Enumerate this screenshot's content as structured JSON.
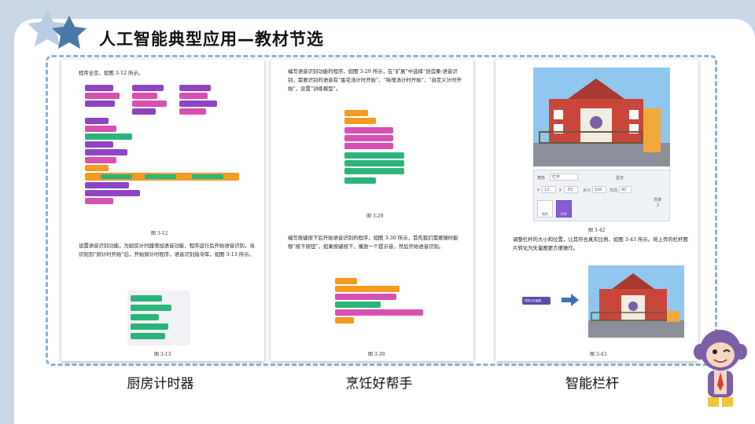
{
  "header": {
    "title": "人工智能典型应用—教材节选"
  },
  "pages": [
    {
      "text_top": "程序全览，如图 3-12 所示。",
      "fig_a": "图 3-12",
      "body": "设置语音识别功能，为厨房计时器增加语音功能，程序运行后开始语音识别，当识别到“倒计时开始”后，开始倒计时程序，语音识别指令库，如图 3-13 所示。",
      "fig_b": "图 3-13",
      "label": "厨房计时器"
    },
    {
      "text_top": "编写语音识别功能的程序，如图 3-29 所示，在“扩展”中选择“创造栗-语音识别，需要识别的语音有“蛋花汤计时开始”、“咏增汤计时开始”、“自定义计时开始”，设置“训练模型”。",
      "fig_a": "图 3-29",
      "body": "编写按键按下后开始语音识别的程序，如图 3-30 所示，首先我们需要随时能够“按下按钮”，如果按键按下，播放一个提示音，然后开始语音识别。",
      "fig_b": "图 3-30",
      "label": "烹饪好帮手"
    },
    {
      "fig_a": "图 3-42",
      "body": "调整栏杆的大小和位置，让其符合真实比例，如图 3-43 所示。将上传的栏杆图片转化为矢量图更方便操作。",
      "fig_b": "图 3-43",
      "label": "智能栏杆",
      "panel": {
        "role_label": "角色",
        "role_name": "栏杆",
        "show_label": "显示",
        "x_label": "x",
        "x_value": "12",
        "y_label": "y",
        "y_value": "-55",
        "size_label": "大小",
        "size_value": "100",
        "dir_label": "方向",
        "dir_value": "90",
        "bg_label": "背景",
        "bg_count": "2",
        "thumb1": "角色",
        "thumb2": "栏杆"
      },
      "arrow_button": "导航为矢量图"
    }
  ]
}
